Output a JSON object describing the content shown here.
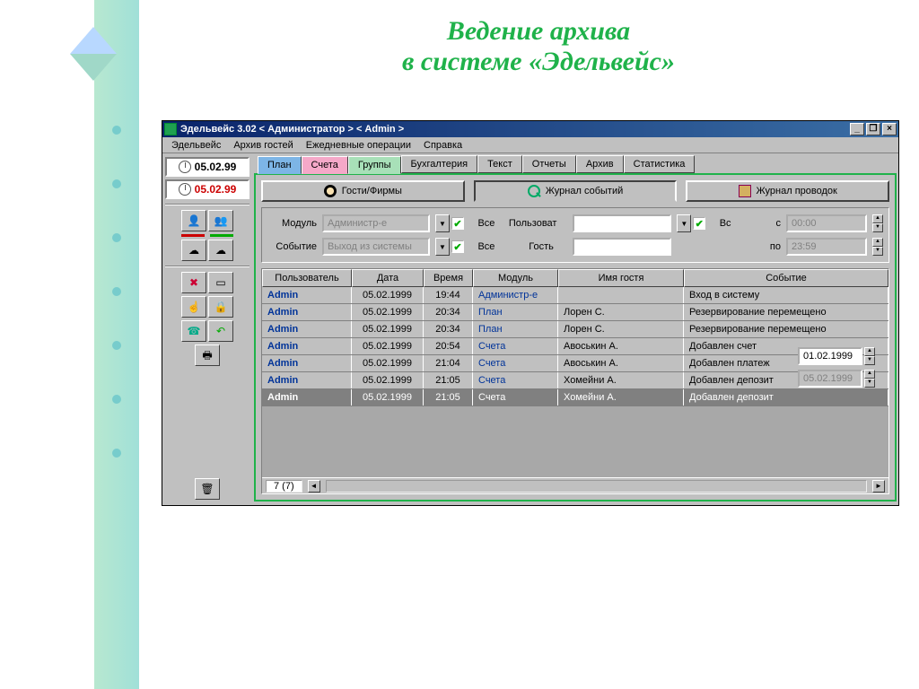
{
  "slide": {
    "title_line1": "Ведение архива",
    "title_line2": "в системе «Эдельвейс»"
  },
  "window": {
    "title": "Эдельвейс 3.02 < Администратор > < Admin >"
  },
  "menu": {
    "m1": "Эдельвейс",
    "m2": "Архив гостей",
    "m3": "Ежедневные операции",
    "m4": "Справка"
  },
  "dates": {
    "black": "05.02.99",
    "red": "05.02.99"
  },
  "tabs": {
    "plan": "План",
    "accounts": "Счета",
    "groups": "Группы",
    "bookkeeping": "Бухгалтерия",
    "text": "Текст",
    "reports": "Отчеты",
    "archive": "Архив",
    "stats": "Статистика"
  },
  "subtabs": {
    "guests": "Гости/Фирмы",
    "journal": "Журнал событий",
    "postings": "Журнал проводок"
  },
  "filters": {
    "module_lbl": "Модуль",
    "module_val": "Администр-е",
    "event_lbl": "Событие",
    "event_val": "Выход из системы",
    "all1": "Все",
    "all2": "Все",
    "user_lbl": "Пользоват",
    "guest_lbl": "Гость",
    "all3": "Вс",
    "from_lbl": "с",
    "to_lbl": "по",
    "from_time": "00:00",
    "to_time": "23:59",
    "from_date": "01.02.1999",
    "to_date": "05.02.1999"
  },
  "columns": {
    "user": "Пользователь",
    "date": "Дата",
    "time": "Время",
    "module": "Модуль",
    "guest": "Имя гостя",
    "event": "Событие"
  },
  "rows": [
    {
      "user": "Admin",
      "date": "05.02.1999",
      "time": "19:44",
      "module": "Администр-е",
      "guest": "",
      "event": "Вход в систему"
    },
    {
      "user": "Admin",
      "date": "05.02.1999",
      "time": "20:34",
      "module": "План",
      "guest": "Лорен С.",
      "event": "Резервирование перемещено"
    },
    {
      "user": "Admin",
      "date": "05.02.1999",
      "time": "20:34",
      "module": "План",
      "guest": "Лорен С.",
      "event": "Резервирование перемещено"
    },
    {
      "user": "Admin",
      "date": "05.02.1999",
      "time": "20:54",
      "module": "Счета",
      "guest": "Авоськин А.",
      "event": "Добавлен счет"
    },
    {
      "user": "Admin",
      "date": "05.02.1999",
      "time": "21:04",
      "module": "Счета",
      "guest": "Авоськин А.",
      "event": "Добавлен платеж"
    },
    {
      "user": "Admin",
      "date": "05.02.1999",
      "time": "21:05",
      "module": "Счета",
      "guest": "Хомейни А.",
      "event": "Добавлен депозит"
    },
    {
      "user": "Admin",
      "date": "05.02.1999",
      "time": "21:05",
      "module": "Счета",
      "guest": "Хомейни А.",
      "event": "Добавлен депозит"
    }
  ],
  "status": {
    "count": "7 (7)"
  }
}
